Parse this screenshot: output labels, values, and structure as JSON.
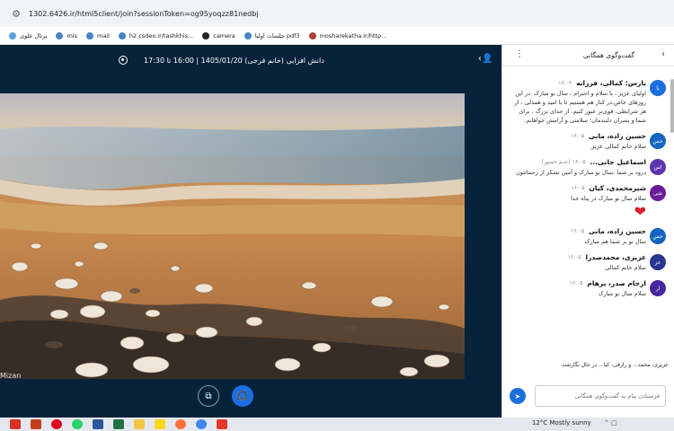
{
  "browser": {
    "url": "1302.6426.ir/html5client/join?sessionToken=og95yoqzz81nedbj",
    "bookmarks": [
      {
        "label": "پرتال علوی",
        "color": "#5aa0e0"
      },
      {
        "label": "mis",
        "color": "#4a84c6"
      },
      {
        "label": "mail",
        "color": "#4a84c6"
      },
      {
        "label": "h2.csdeo.ir/tashkhis...",
        "color": "#4a84c6"
      },
      {
        "label": "camera",
        "color": "#222222"
      },
      {
        "label": "جلسات اولیا pdf3",
        "color": "#4a84c6"
      },
      {
        "label": "mosharekatha.ir/http...",
        "color": "#b04030"
      }
    ]
  },
  "meeting": {
    "title": "دانش افزایی (خانم فرجی) 1405/01/20 | 16:00 تا 17:30",
    "watermark": "Mizan"
  },
  "chat": {
    "title": "گفت‌وگوی همگانی",
    "messages": [
      {
        "initials": "با",
        "color": "#1b6fe0",
        "name": "بارس: کمالی، فرزانه",
        "time": "۱۶:۰۳",
        "text": "اولیای عزیز ، با سلام و احترام ، سال نو مبارک .در این روزهای خاص،در کنار هم هستیم تا با امید و همدلی ، از هر شرایطی، قوی‌تر عبور کنیم. از خدای بزرگ ، برای شما و پسران دلبندمان؛ سلامتی و آرامش خواهانم."
      },
      {
        "initials": "حس",
        "color": "#1565c0",
        "name": "حسین زاده، مانی",
        "time": "۱۶:۰۵",
        "text": "سلام خانم کمالی عزیز."
      },
      {
        "initials": "اس",
        "color": "#5e35b1",
        "name": "اسماعیل جانی...",
        "time": "۱۶:۰۵ (عدم حضور)",
        "text": "درود بر شما ،سال نو مبارک و آمین تشکر از زحماتتون"
      },
      {
        "initials": "شی",
        "color": "#6a1b9a",
        "name": "شیرمحمدی، کیان",
        "time": "۱۶:۰۵",
        "text": "سلام سال نو مبارک در پناه خدا"
      },
      {
        "initials": "حس",
        "color": "#1565c0",
        "name": "حسین زاده، مانی",
        "time": "۱۶:۰۵",
        "text": "سال نو بر شما هم مبارک"
      },
      {
        "initials": "عز",
        "color": "#283593",
        "name": "عزیزی، محمدصدرا",
        "time": "۱۶:۰۵",
        "text": "سلام خانم کمالی"
      },
      {
        "initials": "ار",
        "color": "#4527a0",
        "name": "ارجام صدر، برهام",
        "time": "۱۶:۰۵",
        "text": "سلام سال نو مبارک"
      }
    ],
    "input_placeholder": "فرستادن پیام به گفت‌وگوی همگانی",
    "typing": "عزیزی، محمد... و رازقی، کیا... در حال نگارشند"
  },
  "taskbar": {
    "weather": "12°C  Mostly sunny"
  }
}
